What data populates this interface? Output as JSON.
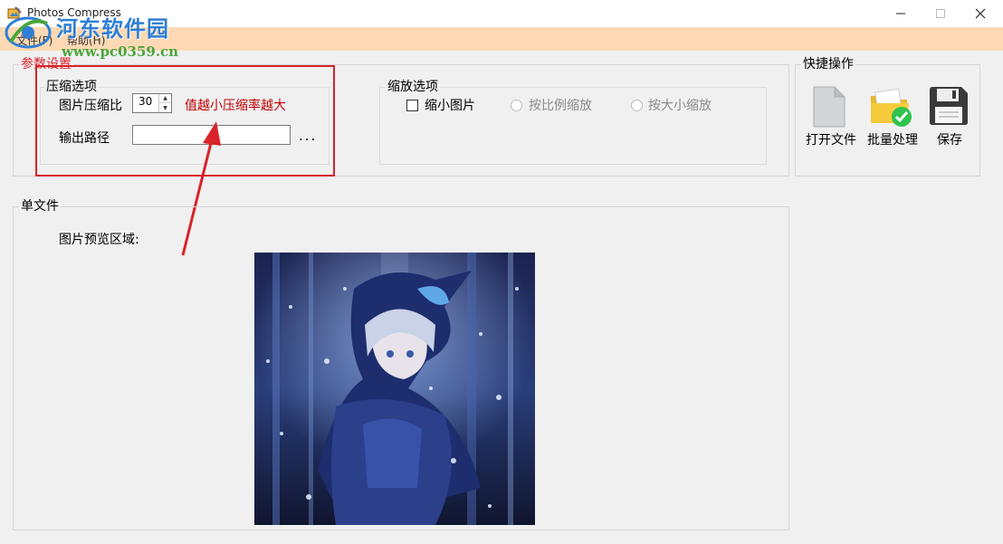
{
  "window": {
    "title": "Photos Compress"
  },
  "watermark": {
    "site_cn": "河东软件园",
    "site_url": "www.pc0359.cn"
  },
  "menu": {
    "file": "文件(F)",
    "help": "帮助(H)"
  },
  "params": {
    "group_title": "参数设置",
    "compress": {
      "title": "压缩选项",
      "ratio_label": "图片压缩比",
      "ratio_value": "30",
      "hint": "值越小压缩率越大",
      "output_label": "输出路径",
      "output_value": "",
      "browse_label": "..."
    },
    "scale": {
      "title": "缩放选项",
      "shrink_label": "缩小图片",
      "by_ratio_label": "按比例缩放",
      "by_size_label": "按大小缩放"
    }
  },
  "quick": {
    "title": "快捷操作",
    "open_label": "打开文件",
    "batch_label": "批量处理",
    "save_label": "保存"
  },
  "single": {
    "title": "单文件",
    "preview_label": "图片预览区域:"
  },
  "colors": {
    "menubar_bg": "#fcd9b4",
    "highlight_red": "#d8232a",
    "hint_red": "#c00000",
    "watermark_blue": "#2f7fd6",
    "watermark_green": "#4aa53a"
  },
  "icons": {
    "app": "app-icon",
    "minimize": "minimize-icon",
    "maximize": "maximize-icon",
    "close": "close-icon",
    "open_file": "document-icon",
    "batch": "folder-check-icon",
    "save": "floppy-disk-icon",
    "annotation": "red-arrow-icon"
  }
}
